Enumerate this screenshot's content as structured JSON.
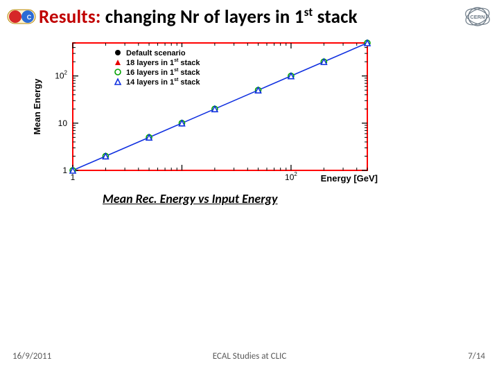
{
  "header": {
    "title_prefix": "Results:",
    "title_rest": " changing Nr of layers in 1",
    "title_super": "st",
    "title_tail": " stack",
    "clic_logo_name": "clic-logo",
    "cern_logo_name": "cern-logo"
  },
  "plot": {
    "subtitle": "Mean Rec. Energy vs Input  Energy",
    "ylabel": "Mean Energy",
    "xlabel": "Energy [GeV]",
    "legend_items": [
      {
        "marker": "filled-circle",
        "label": "Default scenario"
      },
      {
        "marker": "filled-triangle",
        "label_pre": "18 layers in 1",
        "label_sup": "st",
        "label_post": " stack"
      },
      {
        "marker": "open-circle",
        "label_pre": "16 layers in 1",
        "label_sup": "st",
        "label_post": " stack"
      },
      {
        "marker": "open-triangle",
        "label_pre": "14 layers in 1",
        "label_sup": "st",
        "label_post": " stack"
      }
    ],
    "xticks": [
      "1",
      "10^2"
    ],
    "yticks": [
      "1",
      "10",
      "10^2"
    ]
  },
  "chart_data": {
    "type": "line",
    "title": "Mean Rec. Energy vs Input Energy",
    "xlabel": "Energy [GeV]",
    "ylabel": "Mean Energy",
    "xscale": "log",
    "yscale": "log",
    "xlim": [
      1,
      500
    ],
    "ylim": [
      1,
      500
    ],
    "legend_position": "top-left",
    "x": [
      1,
      2,
      5,
      10,
      20,
      50,
      100,
      200,
      500
    ],
    "series": [
      {
        "name": "Default scenario",
        "marker": "filled-circle",
        "color": "#000000",
        "values": [
          1,
          2,
          5,
          10,
          20,
          50,
          100,
          200,
          500
        ]
      },
      {
        "name": "18 layers in 1st stack",
        "marker": "filled-triangle",
        "color": "#e60000",
        "values": [
          1,
          2,
          5,
          10,
          20,
          50,
          100,
          200,
          500
        ]
      },
      {
        "name": "16 layers in 1st stack",
        "marker": "open-circle",
        "color": "#00a000",
        "values": [
          1,
          2,
          5,
          10,
          20,
          50,
          100,
          200,
          500
        ]
      },
      {
        "name": "14 layers in 1st stack",
        "marker": "open-triangle",
        "color": "#1030e0",
        "values": [
          1,
          2,
          5,
          10,
          20,
          50,
          100,
          200,
          500
        ]
      }
    ]
  },
  "footer": {
    "date": "16/9/2011",
    "center": "ECAL Studies at CLIC",
    "page": "7/14"
  }
}
